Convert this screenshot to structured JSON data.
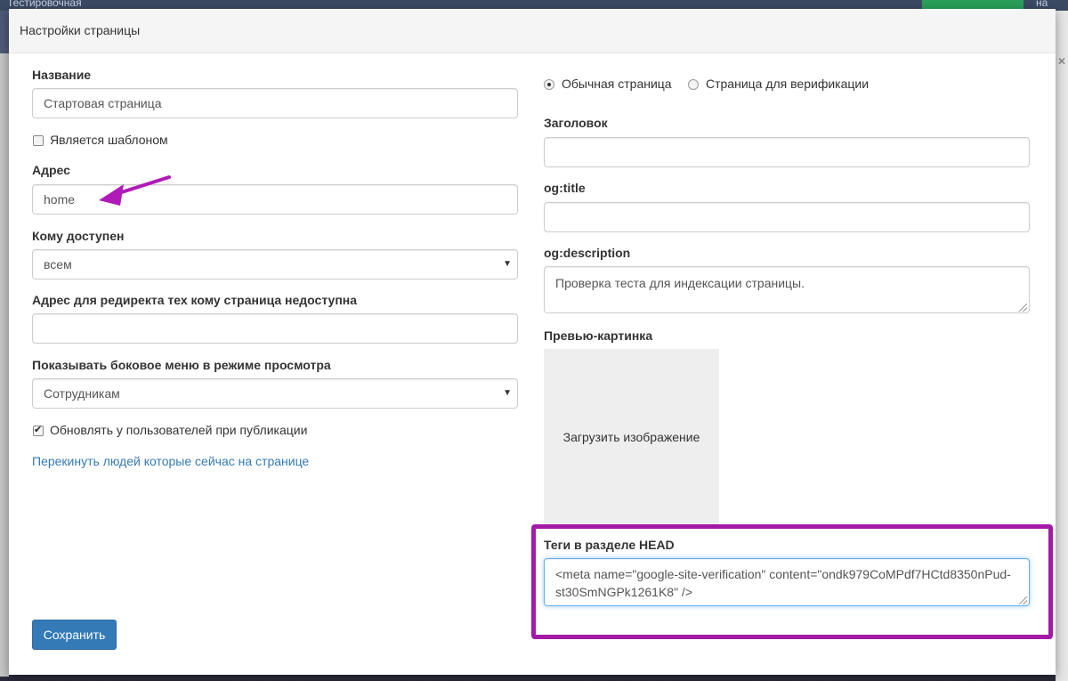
{
  "background": {
    "app_title": "Тестировочная",
    "right_label": "на"
  },
  "modal": {
    "title": "Настройки страницы"
  },
  "left": {
    "name_label": "Название",
    "name_value": "Стартовая страница",
    "template_checkbox_label": "Является шаблоном",
    "template_checked": false,
    "address_label": "Адрес",
    "address_value": "home",
    "access_label": "Кому доступен",
    "access_value": "всем",
    "redirect_label": "Адрес для редиректа тех кому страница недоступна",
    "redirect_value": "",
    "sidebar_label": "Показывать боковое меню в режиме просмотра",
    "sidebar_value": "Сотрудникам",
    "update_checkbox_label": "Обновлять у пользователей при публикации",
    "update_checked": true,
    "redirect_people_link": "Перекинуть людей которые сейчас на странице",
    "save_button": "Сохранить"
  },
  "right": {
    "radio_normal_label": "Обычная страница",
    "radio_verify_label": "Страница для верификации",
    "selected_type": "normal",
    "heading_label": "Заголовок",
    "heading_value": "",
    "og_title_label": "og:title",
    "og_title_value": "",
    "og_description_label": "og:description",
    "og_description_value": "Проверка теста для индексации страницы.",
    "preview_label": "Превью-картинка",
    "upload_label": "Загрузить изображение",
    "head_tags_label": "Теги в разделе HEAD",
    "head_tags_value": "<meta name=\"google-site-verification\" content=\"ondk979CoMPdf7HCtd8350nPud-st30SmNGPk1261K8\" />"
  },
  "annotations": {
    "highlight_color": "#a21aa6",
    "arrow_color": "#b01ab8"
  },
  "colors": {
    "primary": "#337ab7",
    "link": "#337ab7"
  }
}
